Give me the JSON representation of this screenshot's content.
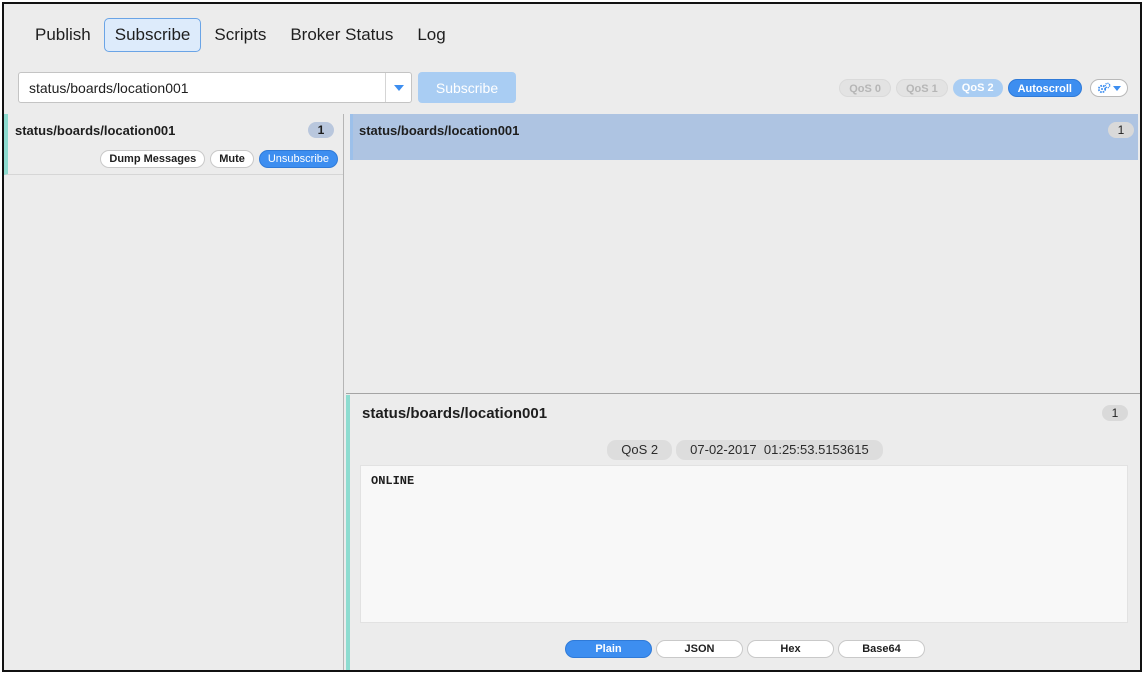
{
  "tabs": [
    {
      "label": "Publish",
      "active": false
    },
    {
      "label": "Subscribe",
      "active": true
    },
    {
      "label": "Scripts",
      "active": false
    },
    {
      "label": "Broker Status",
      "active": false
    },
    {
      "label": "Log",
      "active": false
    }
  ],
  "topic_input": {
    "value": "status/boards/location001"
  },
  "subscribe_button": {
    "label": "Subscribe"
  },
  "options": {
    "qos0": "QoS 0",
    "qos1": "QoS 1",
    "qos2": "QoS 2",
    "autoscroll": "Autoscroll",
    "selected_qos": "QoS 2"
  },
  "subscriptions": [
    {
      "topic": "status/boards/location001",
      "count": "1",
      "buttons": {
        "dump": "Dump Messages",
        "mute": "Mute",
        "unsubscribe": "Unsubscribe"
      }
    }
  ],
  "messages": [
    {
      "topic": "status/boards/location001",
      "count": "1"
    }
  ],
  "detail": {
    "topic": "status/boards/location001",
    "count": "1",
    "qos": "QoS 2",
    "timestamp": "07-02-2017  01:25:53.5153615",
    "payload": "ONLINE",
    "formats": [
      "Plain",
      "JSON",
      "Hex",
      "Base64"
    ],
    "selected_format": "Plain"
  },
  "colors": {
    "accent": "#3d8ef0",
    "accent_light": "#a9cdf3",
    "selection": "#aec4e2",
    "teal_marker": "#8edcd0"
  },
  "icons": {
    "combo_arrow": "chevron-down-icon",
    "settings": "gear-icon"
  }
}
